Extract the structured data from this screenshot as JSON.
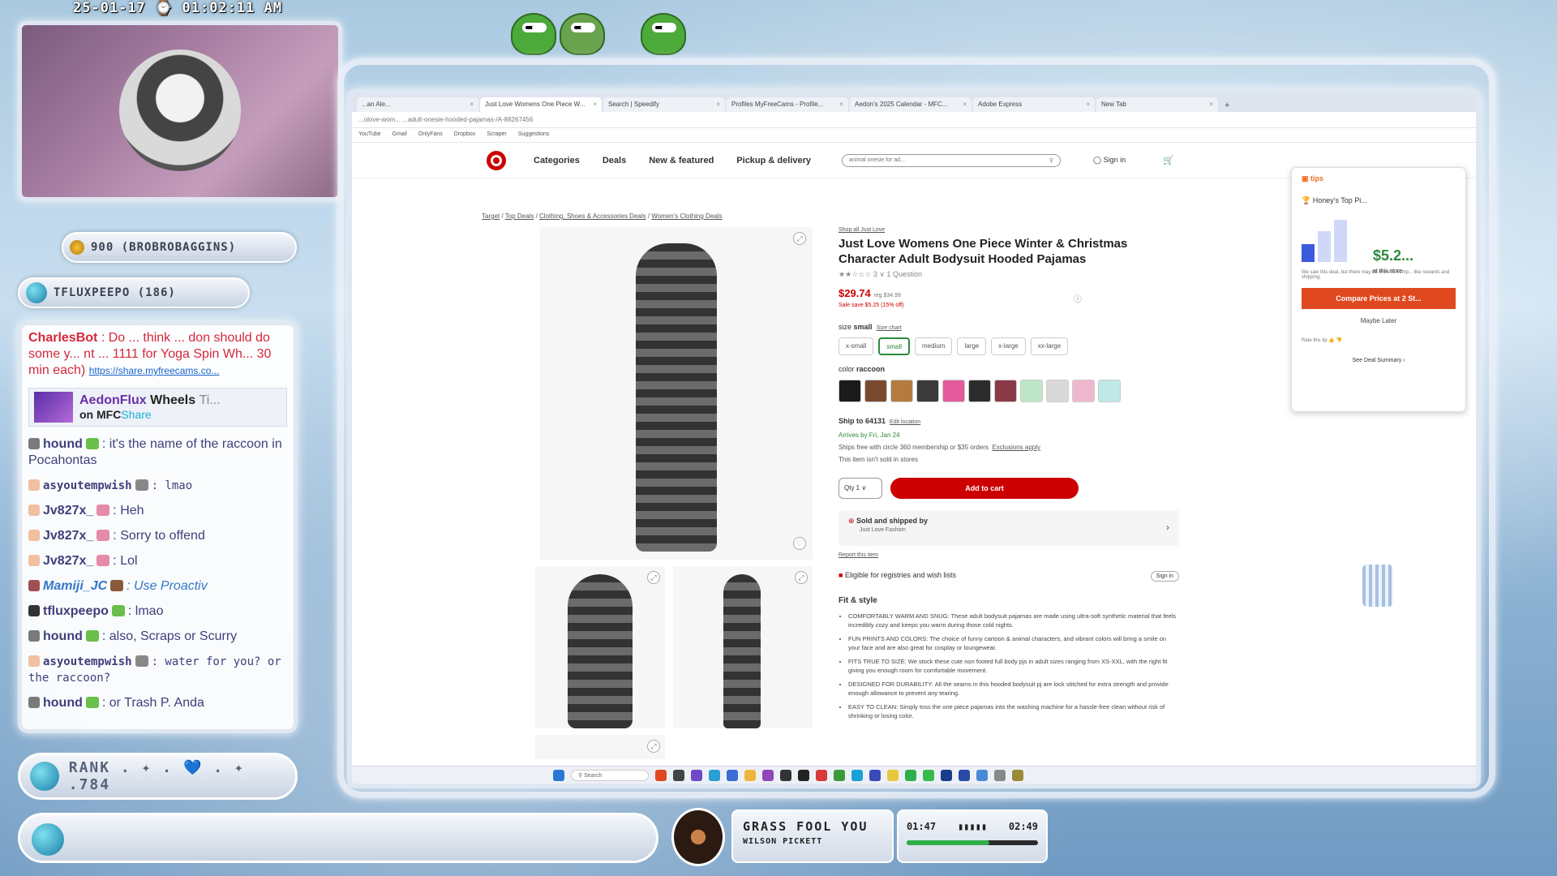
{
  "overlay": {
    "timestamp": "25-01-17 ⌚ 01:02:11 AM",
    "points_badge": "900 (BROBROBAGGINS)",
    "user_badge": "TFLUXPEEPO (186)",
    "rank_label": "RANK . ✦ . 💙 . ✦ .784"
  },
  "chat": {
    "messages": [
      {
        "user": "CharlesBot",
        "text": ": Do ... think ... don should do some y... nt ... 1111 for Yoga Spin Wh... 30 min each)",
        "link": "https://share.myfreecams.co...",
        "style": "bot"
      },
      {
        "user": "hound",
        "text": ": it's the name of the raccoon in Pocahontas",
        "style": "normal"
      },
      {
        "user": "asyoutempwish",
        "text": ": lmao",
        "style": "mono"
      },
      {
        "user": "Jv827x_",
        "text": ": Heh",
        "style": "normal"
      },
      {
        "user": "Jv827x_",
        "text": ": Sorry to offend",
        "style": "normal"
      },
      {
        "user": "Jv827x_",
        "text": ": Lol",
        "style": "normal"
      },
      {
        "user": "Mamiji_JC",
        "text": ": Use Proactiv",
        "style": "italic"
      },
      {
        "user": "tfluxpeepo",
        "text": ": lmao",
        "style": "normal"
      },
      {
        "user": "hound",
        "text": ": also, Scraps or Scurry",
        "style": "normal"
      },
      {
        "user": "asyoutempwish",
        "text": ": water for you? or the raccoon?",
        "style": "mono"
      },
      {
        "user": "hound",
        "text": ": or Trash P. Anda",
        "style": "normal"
      }
    ],
    "promo": {
      "line1_a": "AedonFlux",
      "line1_b": "Wheels",
      "line1_c": "Ti...",
      "line2_a": "on",
      "line2_b": "MFC",
      "line2_c": "Share"
    }
  },
  "now_playing": {
    "title": "GRASS FOOL YOU",
    "artist": "WILSON PICKETT",
    "elapsed": "01:47",
    "total": "02:49",
    "progress": 0.63,
    "bars": "▮▮▮▮▮"
  },
  "browser": {
    "tabs": [
      {
        "label": "...an Ale...",
        "active": false
      },
      {
        "label": "Just Love Womens One Piece W...",
        "active": true
      },
      {
        "label": "Search | Speedify",
        "active": false
      },
      {
        "label": "Profiles MyFreeCams - Profile...",
        "active": false
      },
      {
        "label": "Aedon's 2025 Calendar - MFC...",
        "active": false
      },
      {
        "label": "Adobe Express",
        "active": false
      },
      {
        "label": "New Tab",
        "active": false
      }
    ],
    "new_tab": "+",
    "address": "...olove-wom... ...adult-onesie-hooded-pajamas-/A-88267456",
    "bookmarks": [
      "YouTube",
      "Gmail",
      "OnlyFans",
      "Dropbox",
      "Scraper",
      "Suggestions"
    ]
  },
  "target": {
    "nav": [
      "Categories",
      "Deals",
      "New & featured",
      "Pickup & delivery"
    ],
    "search_placeholder": "animal onesie for ad...",
    "signin": "Sign in",
    "breadcrumb": [
      "Target",
      "Top Deals",
      "Clothing, Shoes & Accessories Deals",
      "Women's Clothing Deals"
    ],
    "brand_link": "Shop all Just Love",
    "title": "Just Love Womens One Piece Winter & Christmas Character Adult Bodysuit Hooded Pajamas",
    "rating_text": "★★☆☆☆ 3 ∨   1 Question",
    "price": "$29.74",
    "price_reg": "reg $34.99",
    "sale_text": "Sale  save $5.25 (15% off)",
    "size_label": "size",
    "size_value": "small",
    "size_chart": "Size chart",
    "sizes": [
      "x-small",
      "small",
      "medium",
      "large",
      "x-large",
      "xx-large"
    ],
    "selected_size": "small",
    "color_label": "color",
    "color_value": "raccoon",
    "swatch_colors": [
      "#1b1b1b",
      "#7a4a2e",
      "#b47b3e",
      "#3a3a3a",
      "#e45a9a",
      "#2c2c2c",
      "#8a3a46",
      "#bfe5c8",
      "#d9d9d9",
      "#f0b8cf",
      "#bfe9e6"
    ],
    "ship_to": "Ship to 64131",
    "edit_location": "Edit location",
    "arrives": "Arrives by Fri, Jan 24",
    "ships_free": "Ships free with  circle 360  membership or $35 orders",
    "exclusions": "Exclusions apply",
    "not_in_stores": "This item isn't sold in stores",
    "qty": "Qty  1 ∨",
    "add_to_cart": "Add to cart",
    "sold_by": "Sold and shipped by",
    "sold_by_name": "Just Love Fashion",
    "report": "Report this item",
    "registry": "Eligible for registries and wish lists",
    "registry_signin": "Sign in",
    "fit_style": "Fit & style",
    "bullets": [
      "COMFORTABLY WARM AND SNUG: These adult bodysuit pajamas are made using ultra-soft synthetic material that feels incredibly cozy and keeps you warm during those cold nights.",
      "FUN PRINTS AND COLORS: The choice of funny cartoon & animal characters, and vibrant colors will bring a smile on your face and are also great for cosplay or loungewear.",
      "FITS TRUE TO SIZE: We stock these cute non footed full body pjs in adult sizes ranging from XS-XXL, with the right fit giving you enough room for comfortable movement.",
      "DESIGNED FOR DURABILITY: All the seams in this hooded bodysuit pj are lock stitched for extra strength and provide enough allowance to prevent any tearing.",
      "EASY TO CLEAN: Simply toss the one piece pajamas into the washing machine for a hassle-free clean without risk of shrinking or losing color."
    ]
  },
  "honey": {
    "header": "tips",
    "top_pick": "Honey's Top Pi...",
    "price": "$5.2...",
    "at_store": "at this store",
    "fine": "We saw this deal, but there may be more to comp... like rewards and shipping.",
    "compare": "Compare Prices at 2 St...",
    "later": "Maybe Later",
    "rate": "Rate this tip",
    "deal_summary": "See Deal Summary  ›"
  },
  "taskbar": {
    "search": "Search"
  }
}
